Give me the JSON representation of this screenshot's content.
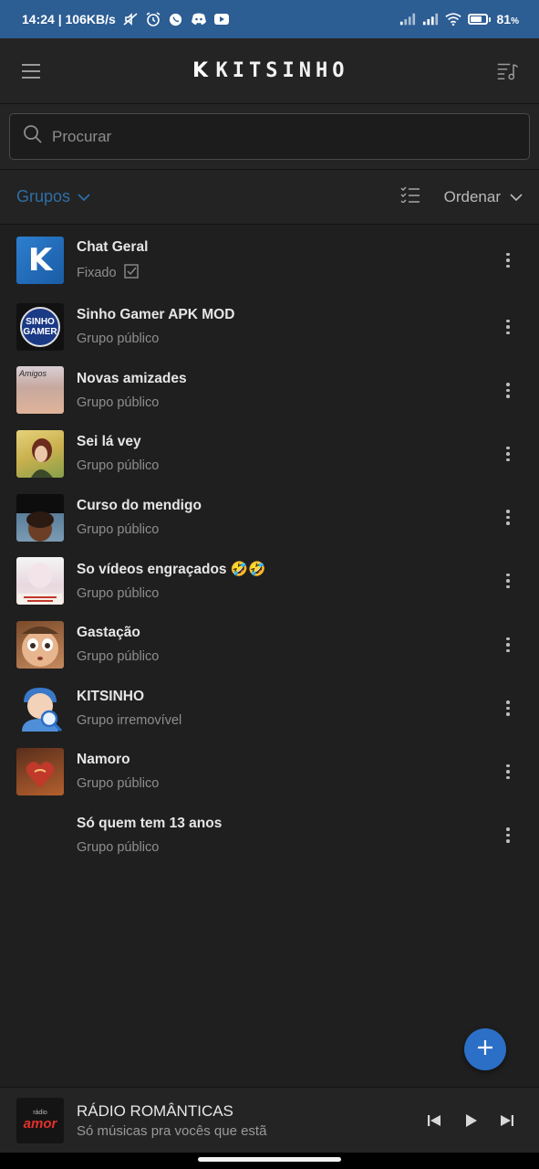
{
  "status_bar": {
    "time_speed": "14:24 | 106KB/s",
    "battery_pct": "81",
    "battery_unit": "%",
    "battery_level": 0.81,
    "icons": [
      "mute-icon",
      "alarm-icon",
      "whatsapp-icon",
      "discord-icon",
      "youtube-icon",
      "signal-icon",
      "signal-icon",
      "wifi-icon",
      "battery-icon"
    ]
  },
  "app_bar": {
    "logo_letter": "K",
    "logo_text": "KITSINHO",
    "menu_icon": "hamburger-icon",
    "right_icon": "music-queue-icon"
  },
  "search": {
    "placeholder": "Procurar"
  },
  "filter": {
    "groups_label": "Grupos",
    "order_label": "Ordenar",
    "accent": "#2f6ea6"
  },
  "groups": [
    {
      "title": "Chat Geral",
      "subtitle": "Fixado",
      "pinned": true
    },
    {
      "title": "Sinho Gamer APK MOD",
      "subtitle": "Grupo público",
      "avatar_text": "SINHO GAMER"
    },
    {
      "title": "Novas amizades",
      "subtitle": "Grupo público",
      "avatar_text": "Amigos"
    },
    {
      "title": "Sei lá vey",
      "subtitle": "Grupo público"
    },
    {
      "title": "Curso do mendigo",
      "subtitle": "Grupo público"
    },
    {
      "title": "So vídeos engraçados 🤣🤣",
      "subtitle": "Grupo público"
    },
    {
      "title": "Gastação",
      "subtitle": "Grupo público"
    },
    {
      "title": "KITSINHO",
      "subtitle": "Grupo irremovível"
    },
    {
      "title": "Namoro",
      "subtitle": "Grupo público"
    },
    {
      "title": "Só quem tem 13 anos",
      "subtitle": "Grupo público"
    }
  ],
  "player": {
    "cover_top": "rádio",
    "cover_main": "amor",
    "title": "RÁDIO ROMÂNTICAS",
    "subtitle": "Só músicas pra vocês que estã"
  },
  "colors": {
    "status_bar": "#2c5d93",
    "background": "#1f1f1f",
    "fab": "#2b6fc7"
  }
}
